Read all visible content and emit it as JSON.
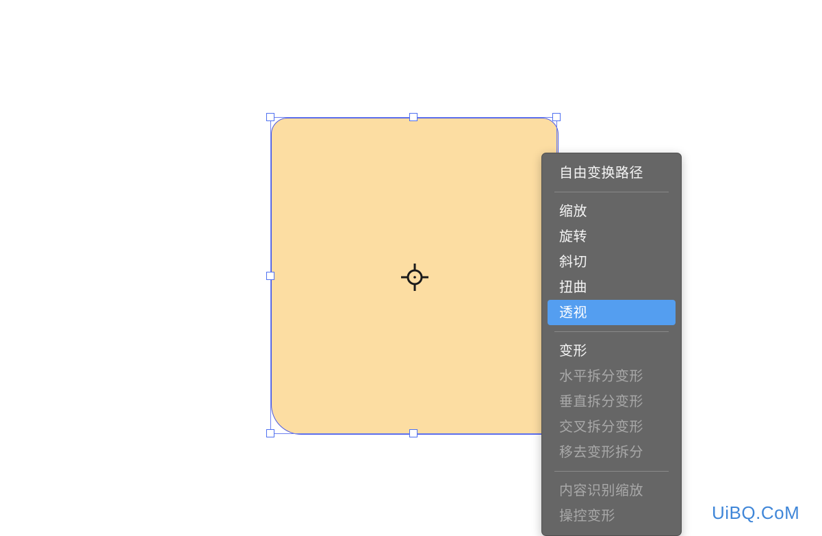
{
  "menu": {
    "items": [
      {
        "label": "自由变换路径",
        "disabled": false
      },
      {
        "separator": true
      },
      {
        "label": "缩放",
        "disabled": false
      },
      {
        "label": "旋转",
        "disabled": false
      },
      {
        "label": "斜切",
        "disabled": false
      },
      {
        "label": "扭曲",
        "disabled": false
      },
      {
        "label": "透视",
        "disabled": false,
        "selected": true
      },
      {
        "separator": true
      },
      {
        "label": "变形",
        "disabled": false
      },
      {
        "label": "水平拆分变形",
        "disabled": true
      },
      {
        "label": "垂直拆分变形",
        "disabled": true
      },
      {
        "label": "交叉拆分变形",
        "disabled": true
      },
      {
        "label": "移去变形拆分",
        "disabled": true
      },
      {
        "separator": true
      },
      {
        "label": "内容识别缩放",
        "disabled": true
      },
      {
        "label": "操控变形",
        "disabled": true
      }
    ]
  },
  "shape": {
    "fill_color": "#fcdda2",
    "stroke_color": "#4a5ae8",
    "handle_color": "#4d6ff0"
  },
  "center_icon": "crosshair-icon",
  "watermark": {
    "text": "UiBQ.CoM",
    "color": "#3f86d8"
  },
  "colors": {
    "menu_bg": "#666666",
    "menu_highlight": "#549ef0"
  }
}
